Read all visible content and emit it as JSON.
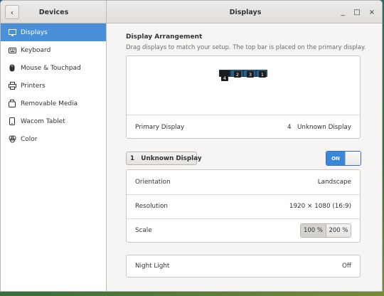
{
  "window": {
    "sidebar_title": "Devices",
    "main_title": "Displays",
    "controls": [
      "_",
      "□",
      "×"
    ]
  },
  "sidebar": {
    "items": [
      {
        "label": "Displays",
        "icon": "display-icon",
        "active": true
      },
      {
        "label": "Keyboard",
        "icon": "keyboard-icon",
        "active": false
      },
      {
        "label": "Mouse & Touchpad",
        "icon": "mouse-icon",
        "active": false
      },
      {
        "label": "Printers",
        "icon": "printer-icon",
        "active": false
      },
      {
        "label": "Removable Media",
        "icon": "removable-media-icon",
        "active": false
      },
      {
        "label": "Wacom Tablet",
        "icon": "tablet-icon",
        "active": false
      },
      {
        "label": "Color",
        "icon": "color-icon",
        "active": false
      }
    ]
  },
  "arrangement": {
    "title": "Display Arrangement",
    "subtitle": "Drag displays to match your setup. The top bar is placed on the primary display.",
    "monitors": [
      "4",
      "2",
      "3",
      "1"
    ],
    "primary_label": "Primary Display",
    "primary_value": "4   Unknown Display"
  },
  "selected_display": {
    "label": "1   Unknown Display",
    "toggle": "ON"
  },
  "settings": {
    "orientation_label": "Orientation",
    "orientation_value": "Landscape",
    "resolution_label": "Resolution",
    "resolution_value": "1920 × 1080 (16:9)",
    "scale_label": "Scale",
    "scale_options": [
      "100 %",
      "200 %"
    ],
    "scale_selected": "100 %"
  },
  "night_light": {
    "label": "Night Light",
    "value": "Off"
  },
  "colors": {
    "accent": "#4a90d9",
    "monitor": "#2b5f86"
  }
}
